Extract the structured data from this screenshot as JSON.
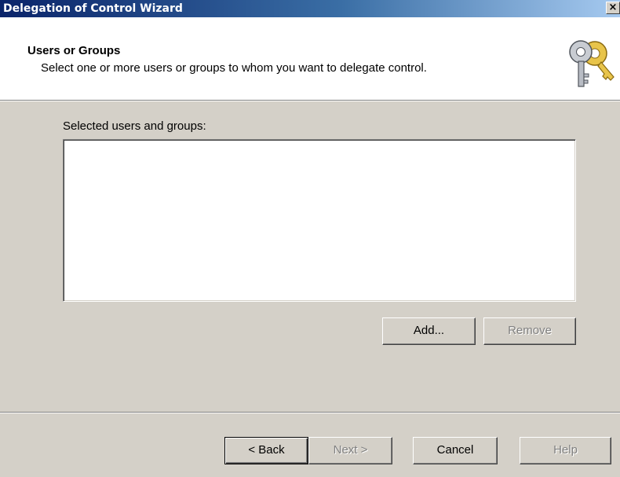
{
  "window": {
    "title": "Delegation of Control Wizard",
    "close_label": "×"
  },
  "header": {
    "title": "Users or Groups",
    "subtitle": "Select one or more users or groups to whom you want to delegate control.",
    "icon": "keys-icon"
  },
  "main": {
    "list_label": "Selected users and groups:",
    "list_items": [],
    "add_label": "Add...",
    "remove_label": "Remove"
  },
  "footer": {
    "back_label": "< Back",
    "next_label": "Next >",
    "cancel_label": "Cancel",
    "help_label": "Help"
  },
  "colors": {
    "title_gradient_start": "#0a246a",
    "title_gradient_end": "#a6caf0",
    "dialog_face": "#d4d0c8",
    "disabled_text": "#808080"
  }
}
